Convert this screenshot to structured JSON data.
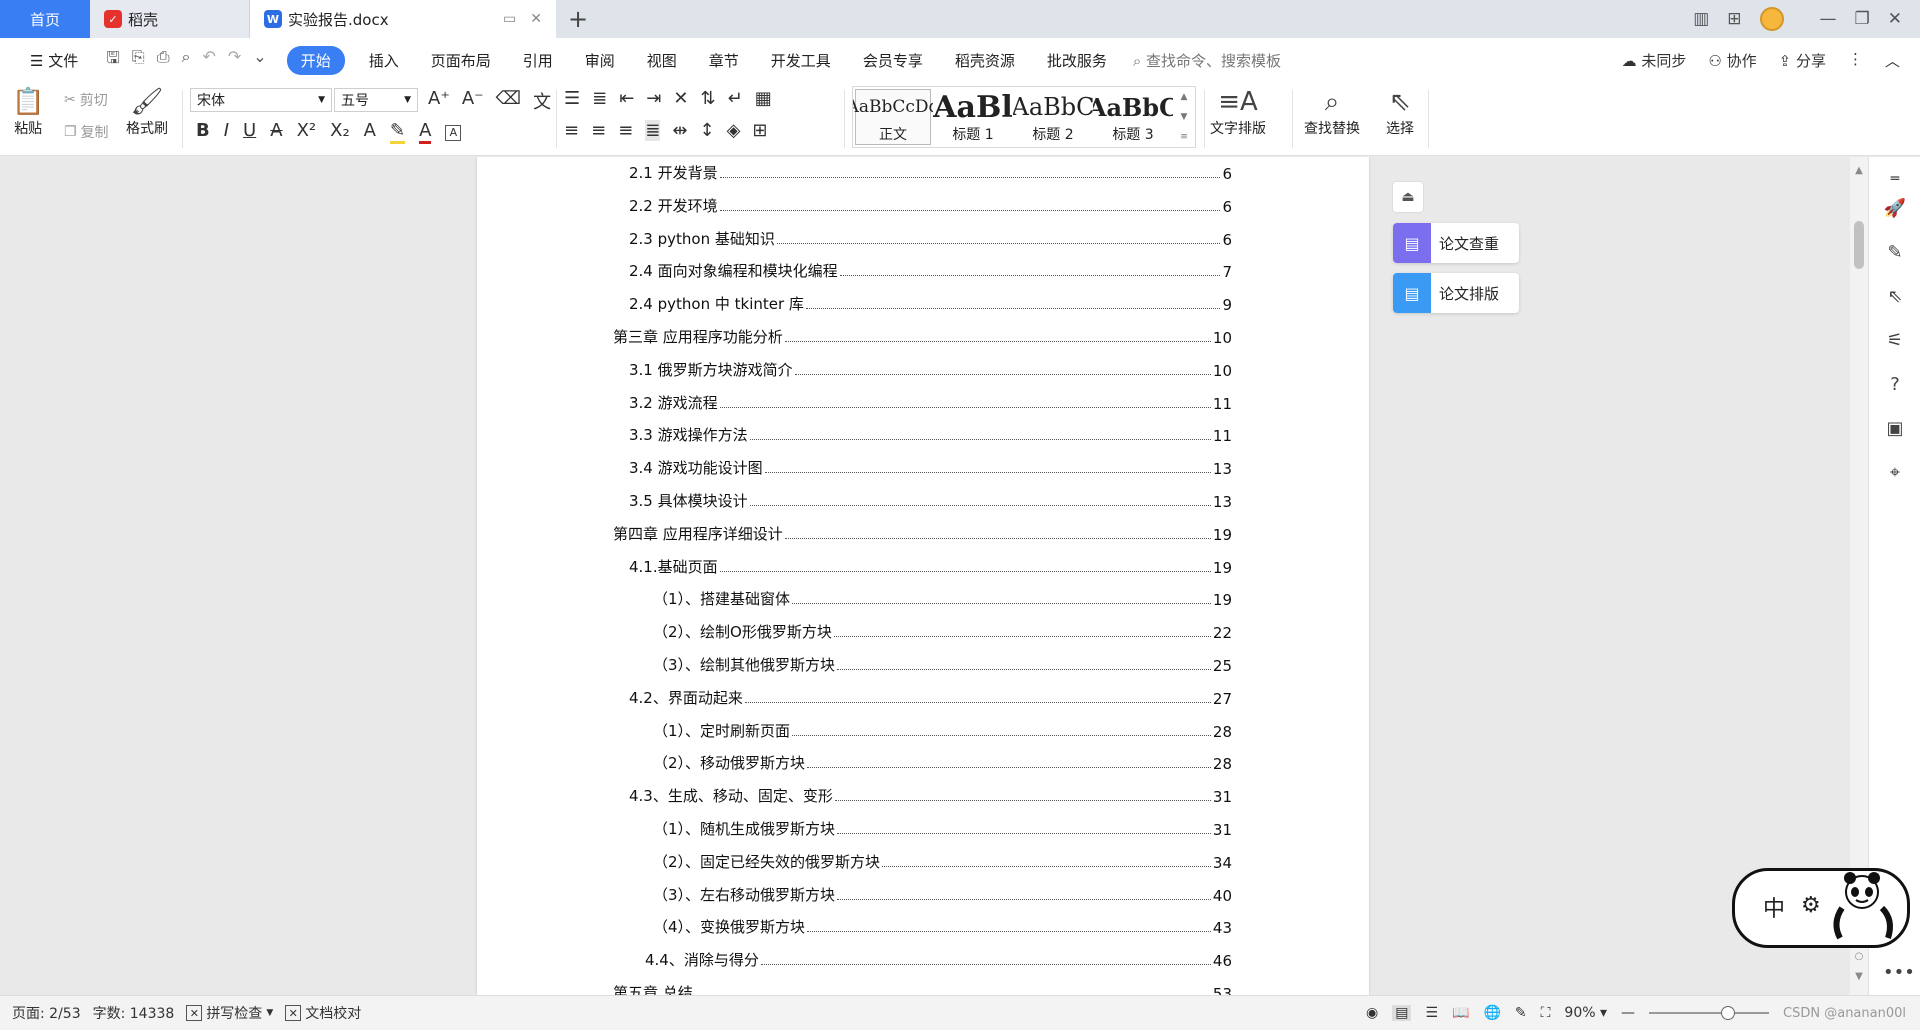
{
  "tabs": {
    "home": "首页",
    "daoke": "稻壳",
    "doc": "实验报告.docx",
    "daoke_icon": "daoke-logo-icon",
    "doc_icon": "wps-writer-icon"
  },
  "menu": {
    "file": "文件",
    "items": [
      "开始",
      "插入",
      "页面布局",
      "引用",
      "审阅",
      "视图",
      "章节",
      "开发工具",
      "会员专享",
      "稻壳资源",
      "批改服务"
    ],
    "search": "查找命令、搜索模板",
    "right": [
      "未同步",
      "协作",
      "分享"
    ]
  },
  "ribbon": {
    "paste": "粘贴",
    "cut": "剪切",
    "copy": "复制",
    "format_painter": "格式刷",
    "font_name": "宋体",
    "font_size": "五号",
    "styles": [
      {
        "sample": "AaBbCcDd",
        "label": "正文"
      },
      {
        "sample": "AaBl",
        "label": "标题 1"
      },
      {
        "sample": "AaBbC",
        "label": "标题 2"
      },
      {
        "sample": "AaBbC",
        "label": "标题 3"
      }
    ],
    "text_layout": "文字排版",
    "find_replace": "查找替换",
    "select": "选择"
  },
  "toc": [
    {
      "text": "2.1 开发背景",
      "page": "6",
      "level": 2
    },
    {
      "text": "2.2 开发环境",
      "page": "6",
      "level": 2
    },
    {
      "text": "2.3 python 基础知识",
      "page": "6",
      "level": 2
    },
    {
      "text": "2.4 面向对象编程和模块化编程",
      "page": "7",
      "level": 2
    },
    {
      "text": "2.4 python 中 tkinter 库",
      "page": "9",
      "level": 2
    },
    {
      "text": "第三章 应用程序功能分析",
      "page": "10",
      "level": 1
    },
    {
      "text": "3.1 俄罗斯方块游戏简介",
      "page": "10",
      "level": 2
    },
    {
      "text": "3.2 游戏流程",
      "page": "11",
      "level": 2
    },
    {
      "text": "3.3 游戏操作方法",
      "page": "11",
      "level": 2
    },
    {
      "text": "3.4 游戏功能设计图",
      "page": "13",
      "level": 2
    },
    {
      "text": "3.5 具体模块设计",
      "page": "13",
      "level": 2
    },
    {
      "text": "第四章  应用程序详细设计",
      "page": "19",
      "level": 1
    },
    {
      "text": "4.1.基础页面",
      "page": "19",
      "level": 2
    },
    {
      "text": "（1）、搭建基础窗体",
      "page": "19",
      "level": 3
    },
    {
      "text": "（2）、绘制O形俄罗斯方块",
      "page": "22",
      "level": 3
    },
    {
      "text": "（3）、绘制其他俄罗斯方块",
      "page": "25",
      "level": 3
    },
    {
      "text": "4.2、界面动起来",
      "page": "27",
      "level": 2
    },
    {
      "text": "（1）、定时刷新页面",
      "page": "28",
      "level": 3
    },
    {
      "text": "（2）、移动俄罗斯方块",
      "page": "28",
      "level": 3
    },
    {
      "text": "4.3、生成、移动、固定、变形",
      "page": "31",
      "level": 2
    },
    {
      "text": "（1）、随机生成俄罗斯方块",
      "page": "31",
      "level": 3
    },
    {
      "text": "（2）、固定已经失效的俄罗斯方块",
      "page": "34",
      "level": 3
    },
    {
      "text": "（3）、左右移动俄罗斯方块",
      "page": "40",
      "level": 3
    },
    {
      "text": "（4）、变换俄罗斯方块",
      "page": "43",
      "level": 3
    },
    {
      "text": "4.4、消除与得分",
      "page": "46",
      "level": 2
    },
    {
      "text": "第五章  总结",
      "page": "53",
      "level": 1
    }
  ],
  "side_panel": {
    "paper_check": "论文查重",
    "paper_layout": "论文排版"
  },
  "mascot": {
    "char1": "中",
    "char2": "⚙"
  },
  "status": {
    "page": "页面: 2/53",
    "words": "字数: 14338",
    "spell": "拼写检查",
    "proof": "文档校对",
    "zoom": "90%",
    "watermark": "CSDN @ananan00l"
  },
  "colors": {
    "accent": "#3a7ef4",
    "paper_check_icon": "#7b6ff0",
    "paper_layout_icon": "#3a9af4"
  }
}
